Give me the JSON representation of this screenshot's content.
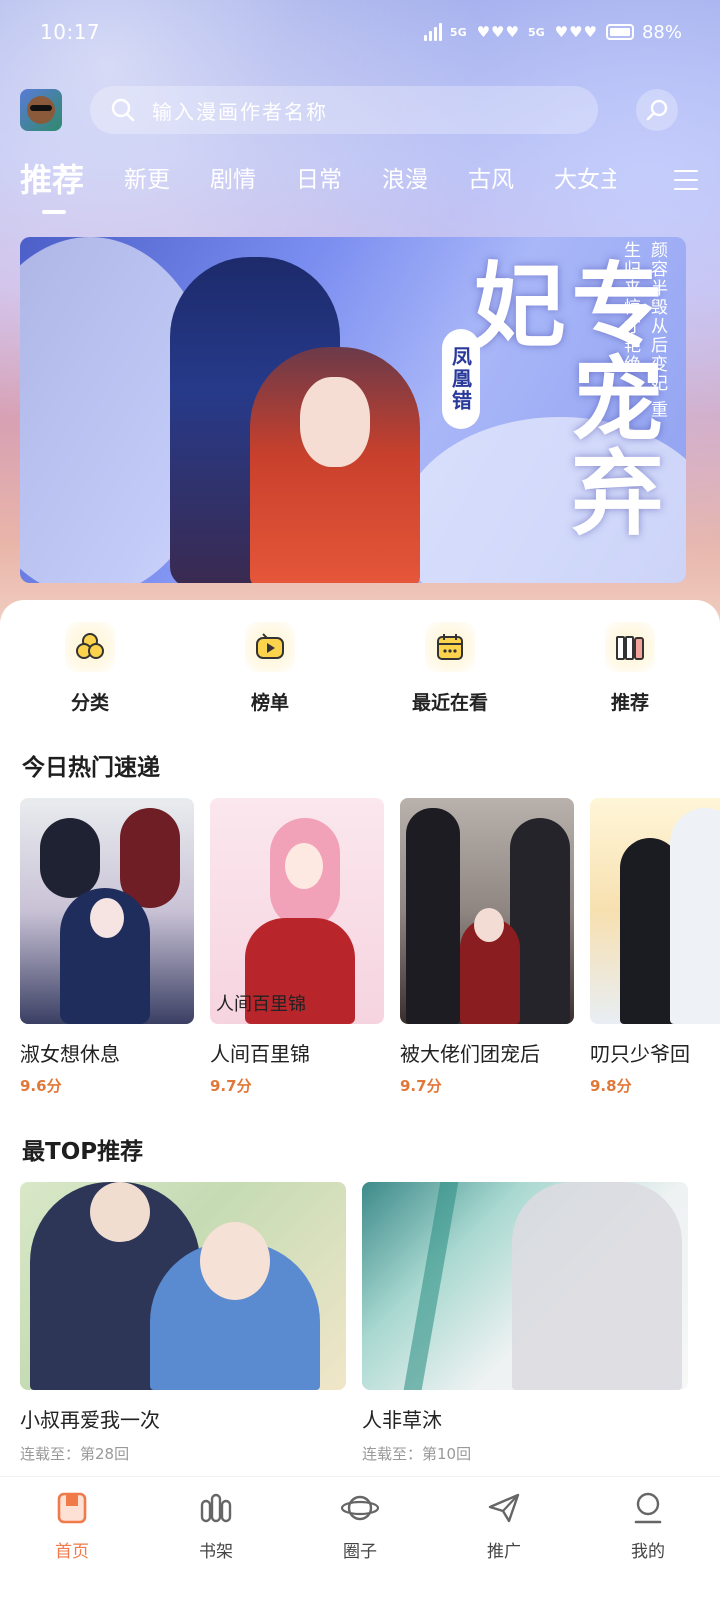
{
  "status_bar": {
    "time": "10:17",
    "network_1": "5G",
    "network_2": "5G",
    "battery": "88%"
  },
  "header": {
    "search_placeholder": "输入漫画作者名称",
    "avatar_icon": "avatar-icon",
    "search_icon": "search-icon",
    "scan_icon": "search-action-icon"
  },
  "tabs": [
    {
      "label": "推荐",
      "active": true
    },
    {
      "label": "新更"
    },
    {
      "label": "剧情"
    },
    {
      "label": "日常"
    },
    {
      "label": "浪漫"
    },
    {
      "label": "古风"
    },
    {
      "label": "大女主"
    }
  ],
  "banner": {
    "title": "专宠弃妃",
    "seal_text": "凤凰错",
    "tagline": "颜容半毁从后变妃 重生归来惊才艳绝"
  },
  "quick_menu": [
    {
      "label": "分类",
      "icon": "category-icon"
    },
    {
      "label": "榜单",
      "icon": "ranking-icon"
    },
    {
      "label": "最近在看",
      "icon": "calendar-icon"
    },
    {
      "label": "推荐",
      "icon": "books-icon"
    }
  ],
  "hot_section": {
    "title": "今日热门速递",
    "items": [
      {
        "title": "淑女想休息",
        "score": "9.6分"
      },
      {
        "title": "人间百里锦",
        "score": "9.7分",
        "cover_text": "人间百里锦"
      },
      {
        "title": "被大佬们团宠后",
        "score": "9.7分"
      },
      {
        "title": "叨只少爷回",
        "score": "9.8分"
      }
    ]
  },
  "top_section": {
    "title": "最TOP推荐",
    "items": [
      {
        "title": "小叔再爱我一次",
        "subtitle": "连载至：第28回"
      },
      {
        "title": "人非草沐",
        "subtitle": "连载至：第10回"
      }
    ]
  },
  "bottom_nav": [
    {
      "label": "首页",
      "icon": "home-icon",
      "active": true
    },
    {
      "label": "书架",
      "icon": "bookshelf-icon"
    },
    {
      "label": "圈子",
      "icon": "planet-icon"
    },
    {
      "label": "推广",
      "icon": "paper-plane-icon"
    },
    {
      "label": "我的",
      "icon": "profile-icon"
    }
  ],
  "colors": {
    "accent": "#f07a4a",
    "score": "#e0783a",
    "top_gradient_start": "#9aa6e8",
    "top_gradient_end": "#f2d2c6"
  }
}
